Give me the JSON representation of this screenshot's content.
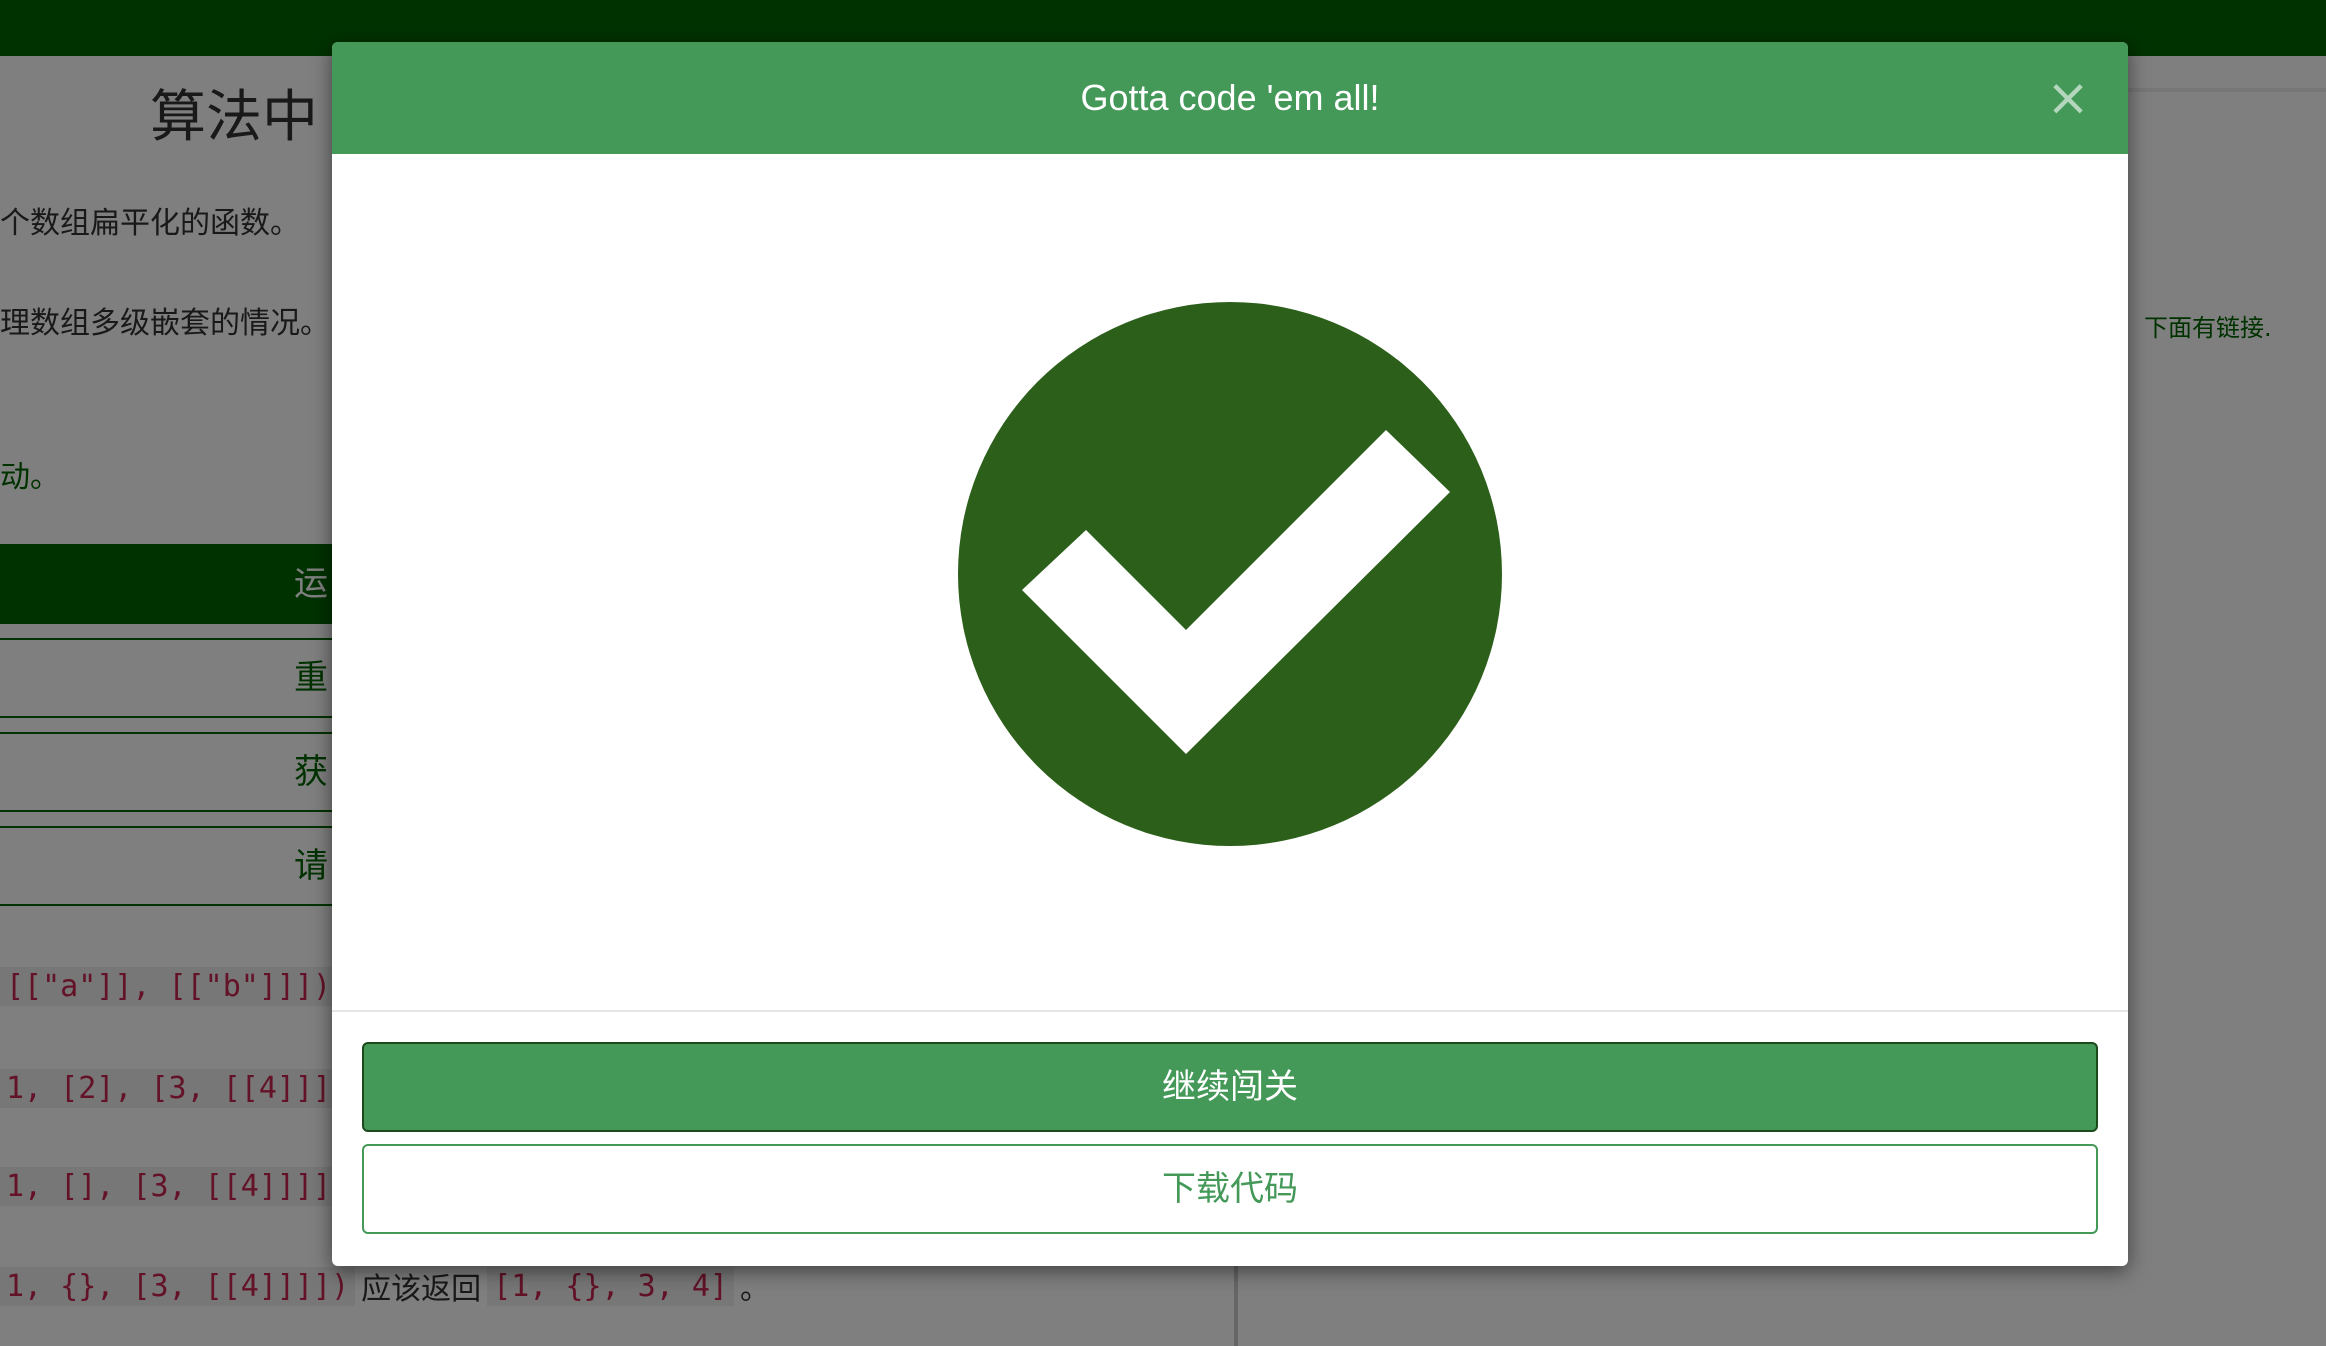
{
  "lesson": {
    "title": "算法中",
    "paragraphs": [
      "个数组扁平化的函数。",
      "理数组多级嵌套的情况。",
      "动。"
    ],
    "buttons": [
      "运",
      "重",
      "获",
      "请"
    ],
    "tests": [
      {
        "code": "[[\"a\"]], [[\"b\"]]])",
        "text": "",
        "result": ""
      },
      {
        "code": "1, [2], [3, [[4]]]",
        "text": "",
        "result": ""
      },
      {
        "code": "1, [], [3, [[4]]]]",
        "text": "",
        "result": ""
      },
      {
        "code": "1, {}, [3, [[4]]]])",
        "text": "应该返回",
        "result": "[1, {}, 3, 4]",
        "end": "。"
      }
    ]
  },
  "right_panel": {
    "link_text": "下面有链接."
  },
  "modal": {
    "title": "Gotta code 'em all!",
    "close_label": "×",
    "success_icon": "check-circle-icon",
    "continue_label": "继续闯关",
    "download_label": "下载代码"
  },
  "colors": {
    "brand_green": "#006400",
    "modal_header": "#449959",
    "check_circle": "#2b5f1a"
  }
}
